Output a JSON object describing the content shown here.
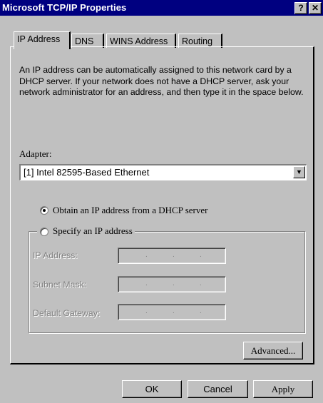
{
  "window": {
    "title": "Microsoft TCP/IP Properties",
    "help_glyph": "?",
    "close_glyph": "✕"
  },
  "tabs": [
    {
      "label": "IP Address",
      "active": true
    },
    {
      "label": "DNS",
      "active": false
    },
    {
      "label": "WINS Address",
      "active": false
    },
    {
      "label": "Routing",
      "active": false
    }
  ],
  "description": "An IP address can be automatically assigned to this network card by a DHCP server.  If your network does not have a DHCP server, ask your network administrator for an address, and then type it in the space below.",
  "adapter": {
    "label": "Adapter:",
    "selected": "[1] Intel 82595-Based Ethernet"
  },
  "options": {
    "dhcp": {
      "label": "Obtain an IP address from a DHCP server",
      "checked": true
    },
    "specify": {
      "label": "Specify an IP address",
      "checked": false
    }
  },
  "fields": {
    "ip_address": {
      "label": "IP Address:"
    },
    "subnet_mask": {
      "label": "Subnet Mask:"
    },
    "default_gateway": {
      "label": "Default Gateway:"
    }
  },
  "buttons": {
    "advanced": "Advanced...",
    "ok": "OK",
    "cancel": "Cancel",
    "apply": "Apply"
  },
  "colors": {
    "titlebar": "#000080",
    "face": "#c0c0c0",
    "disabled_text": "#808080"
  }
}
